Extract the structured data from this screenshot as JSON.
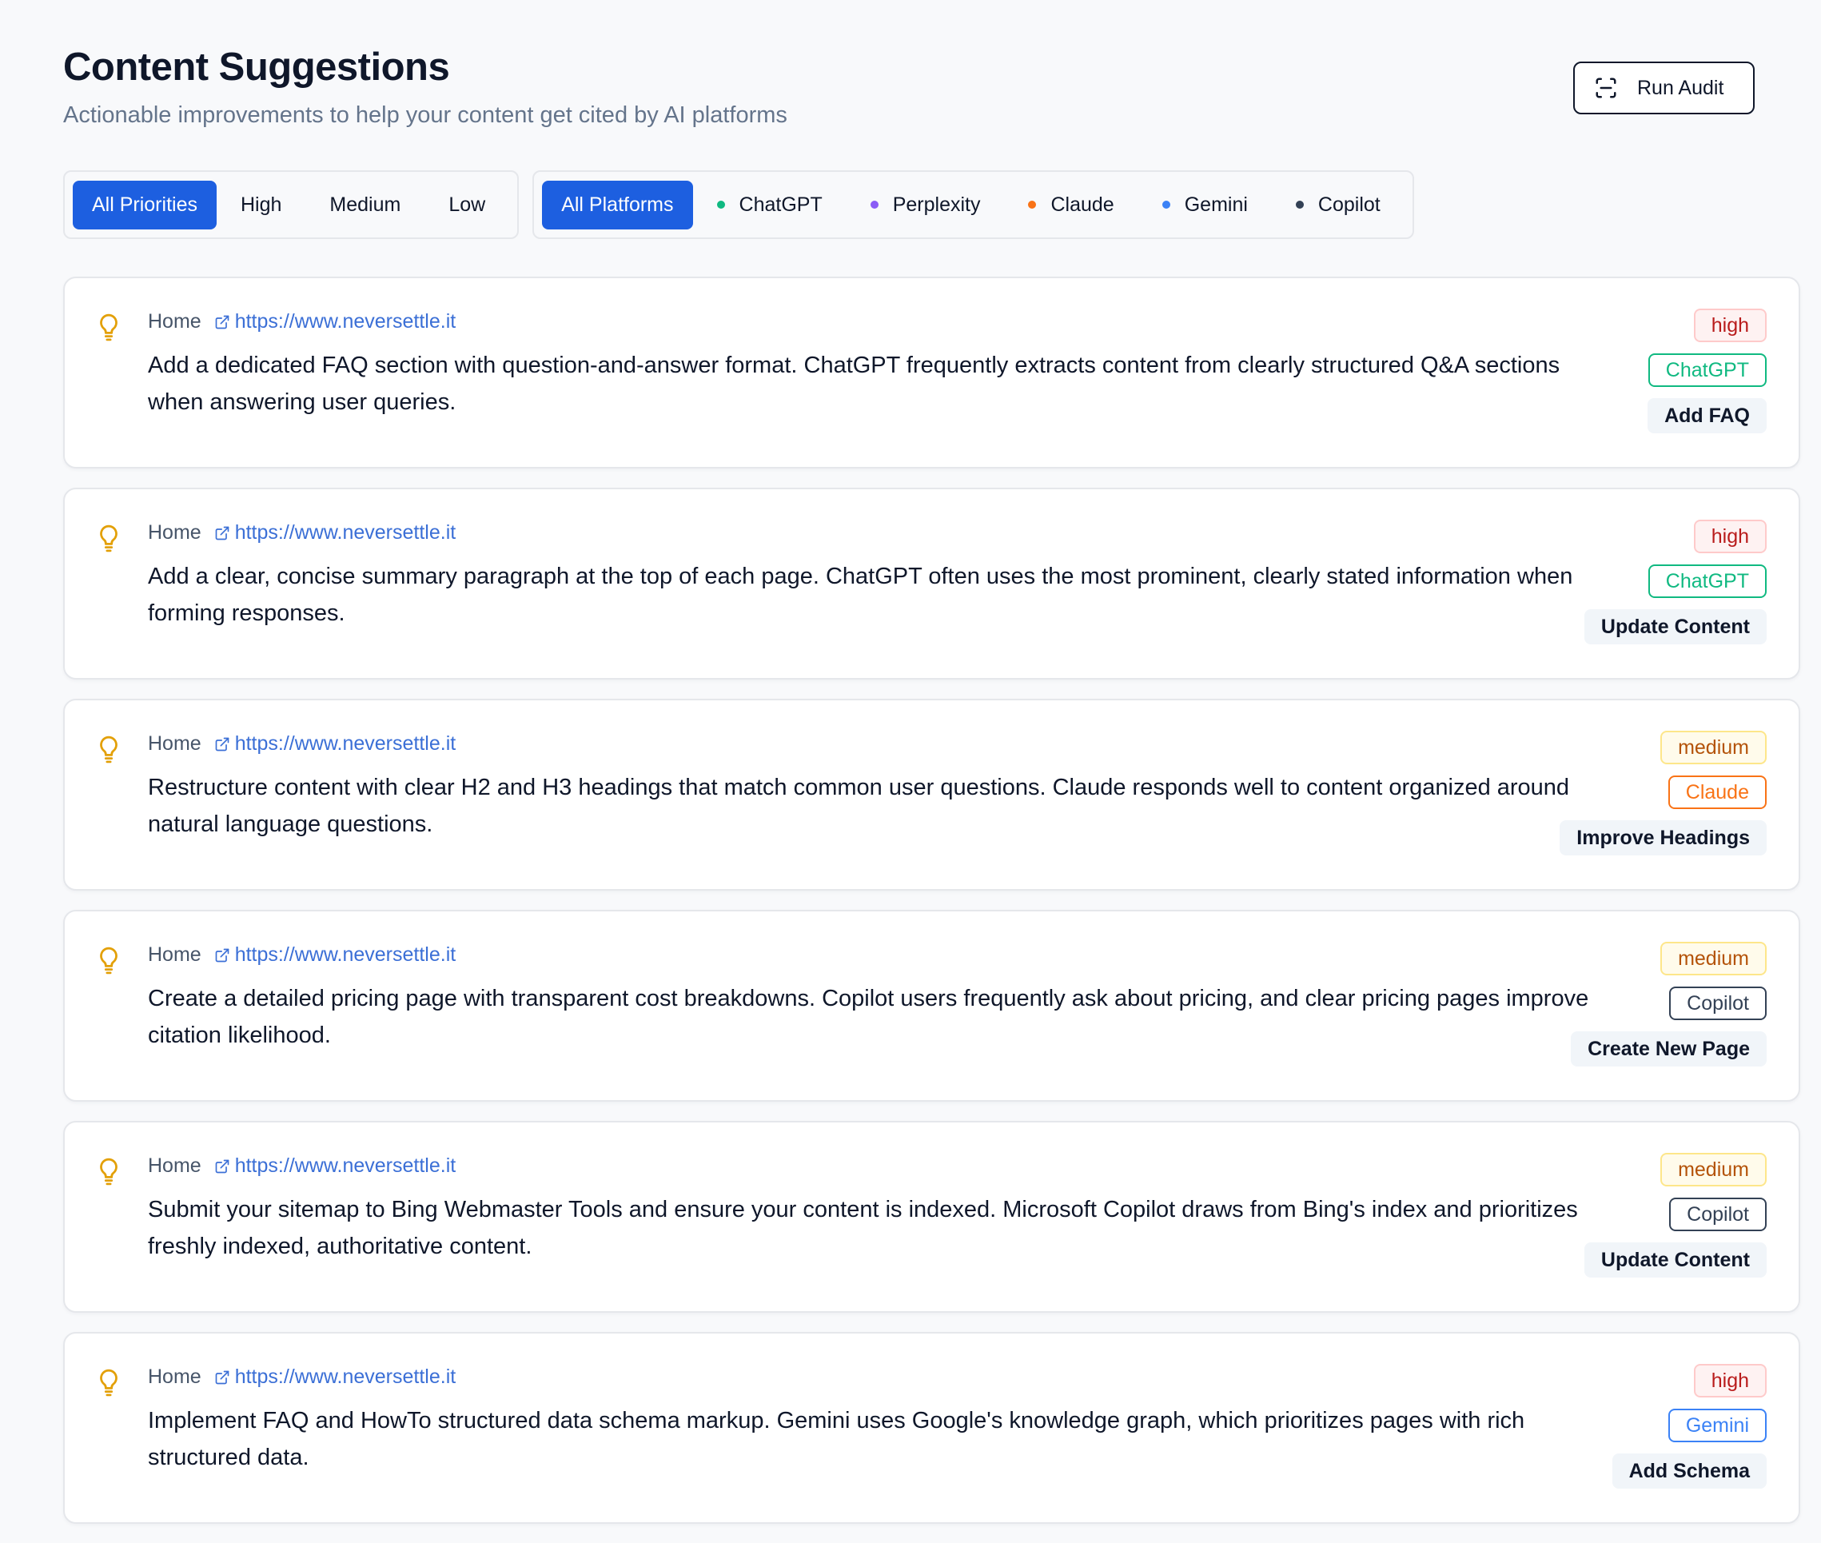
{
  "header": {
    "title": "Content Suggestions",
    "subtitle": "Actionable improvements to help your content get cited by AI platforms",
    "run_audit_label": "Run Audit"
  },
  "priority_filters": [
    {
      "label": "All Priorities",
      "active": true
    },
    {
      "label": "High",
      "active": false
    },
    {
      "label": "Medium",
      "active": false
    },
    {
      "label": "Low",
      "active": false
    }
  ],
  "platform_filters": [
    {
      "label": "All Platforms",
      "active": true,
      "dot": null
    },
    {
      "label": "ChatGPT",
      "active": false,
      "dot": "#10b981"
    },
    {
      "label": "Perplexity",
      "active": false,
      "dot": "#8b5cf6"
    },
    {
      "label": "Claude",
      "active": false,
      "dot": "#f97316"
    },
    {
      "label": "Gemini",
      "active": false,
      "dot": "#3b82f6"
    },
    {
      "label": "Copilot",
      "active": false,
      "dot": "#334155"
    }
  ],
  "badge_colors": {
    "high": {
      "text": "#b91c1c",
      "border": "#fecaca",
      "bg": "#fef2f2"
    },
    "medium": {
      "text": "#b45309",
      "border": "#fde68a",
      "bg": "#fffbeb"
    },
    "ChatGPT": {
      "text": "#10b981",
      "border": "#10b981",
      "bg": "#ffffff"
    },
    "Claude": {
      "text": "#f97316",
      "border": "#f97316",
      "bg": "#ffffff"
    },
    "Copilot": {
      "text": "#334155",
      "border": "#334155",
      "bg": "#ffffff"
    },
    "Gemini": {
      "text": "#3b82f6",
      "border": "#3b82f6",
      "bg": "#ffffff"
    }
  },
  "suggestions": [
    {
      "page": "Home",
      "url": "https://www.neversettle.it",
      "text": "Add a dedicated FAQ section with question-and-answer format. ChatGPT frequently extracts content from clearly structured Q&A sections when answering user queries.",
      "priority": "high",
      "platform": "ChatGPT",
      "action": "Add FAQ"
    },
    {
      "page": "Home",
      "url": "https://www.neversettle.it",
      "text": "Add a clear, concise summary paragraph at the top of each page. ChatGPT often uses the most prominent, clearly stated information when forming responses.",
      "priority": "high",
      "platform": "ChatGPT",
      "action": "Update Content"
    },
    {
      "page": "Home",
      "url": "https://www.neversettle.it",
      "text": "Restructure content with clear H2 and H3 headings that match common user questions. Claude responds well to content organized around natural language questions.",
      "priority": "medium",
      "platform": "Claude",
      "action": "Improve Headings"
    },
    {
      "page": "Home",
      "url": "https://www.neversettle.it",
      "text": "Create a detailed pricing page with transparent cost breakdowns. Copilot users frequently ask about pricing, and clear pricing pages improve citation likelihood.",
      "priority": "medium",
      "platform": "Copilot",
      "action": "Create New Page"
    },
    {
      "page": "Home",
      "url": "https://www.neversettle.it",
      "text": "Submit your sitemap to Bing Webmaster Tools and ensure your content is indexed. Microsoft Copilot draws from Bing's index and prioritizes freshly indexed, authoritative content.",
      "priority": "medium",
      "platform": "Copilot",
      "action": "Update Content"
    },
    {
      "page": "Home",
      "url": "https://www.neversettle.it",
      "text": "Implement FAQ and HowTo structured data schema markup. Gemini uses Google's knowledge graph, which prioritizes pages with rich structured data.",
      "priority": "high",
      "platform": "Gemini",
      "action": "Add Schema"
    }
  ]
}
